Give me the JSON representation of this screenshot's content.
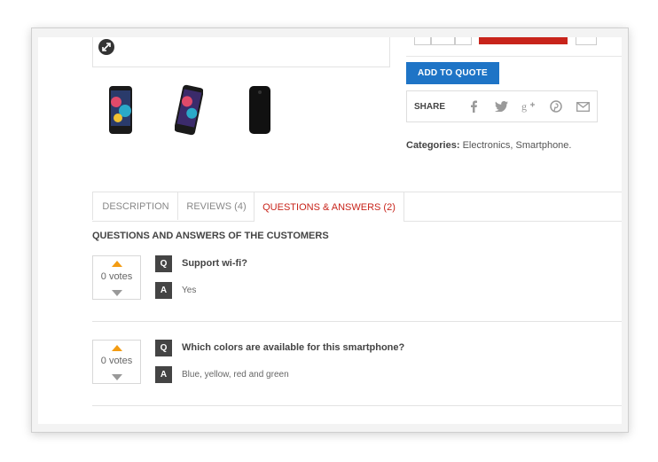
{
  "buttons": {
    "add_to_quote": "ADD TO QUOTE"
  },
  "share": {
    "label": "SHARE",
    "icons": [
      "facebook-icon",
      "twitter-icon",
      "google-plus-icon",
      "pinterest-icon",
      "email-icon"
    ]
  },
  "categories": {
    "label": "Categories:",
    "value": " Electronics, Smartphone."
  },
  "tabs": [
    {
      "label": "DESCRIPTION",
      "active": false
    },
    {
      "label": "REVIEWS (4)",
      "active": false
    },
    {
      "label": "QUESTIONS & ANSWERS (2)",
      "active": true
    }
  ],
  "qa": {
    "title": "QUESTIONS AND ANSWERS OF THE CUSTOMERS",
    "items": [
      {
        "votes": "0 votes",
        "q_badge": "Q",
        "question": "Support wi-fi?",
        "a_badge": "A",
        "answer": "Yes"
      },
      {
        "votes": "0 votes",
        "q_badge": "Q",
        "question": "Which colors are available for this smartphone?",
        "a_badge": "A",
        "answer": "Blue, yellow, red and green"
      }
    ]
  },
  "colors": {
    "accent_red": "#c8241b",
    "button_blue": "#1e74c6",
    "vote_up": "#f39c12"
  }
}
